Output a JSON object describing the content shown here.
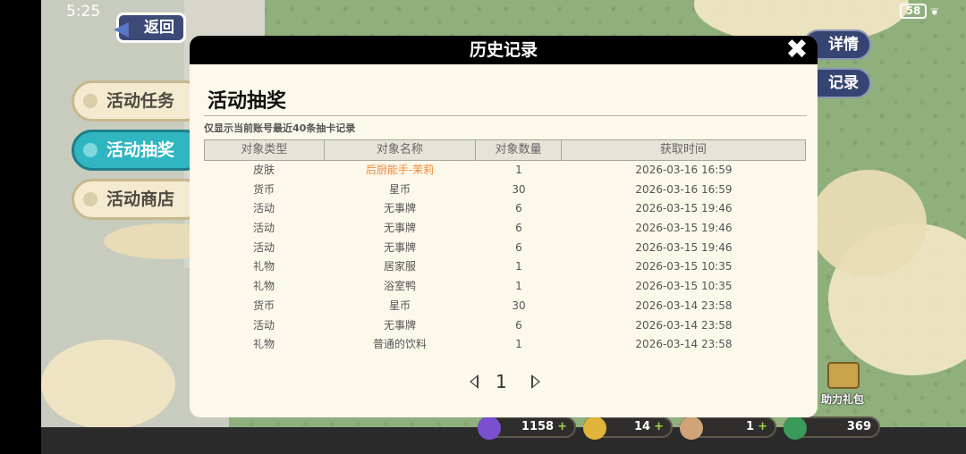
{
  "status": {
    "time": "5:25",
    "battery": "58"
  },
  "nav": {
    "back_label": "返回"
  },
  "sidebar": {
    "tabs": [
      {
        "label": "活动任务",
        "active": false
      },
      {
        "label": "活动抽奖",
        "active": true
      },
      {
        "label": "活动商店",
        "active": false
      }
    ]
  },
  "right_buttons": {
    "details": "详情",
    "records": "记录"
  },
  "gift_pack": {
    "label": "助力礼包"
  },
  "currencies": [
    {
      "icon": "purple-gem-icon",
      "value": "1158",
      "plus": "+"
    },
    {
      "icon": "gold-coin-icon",
      "value": "14",
      "plus": "+"
    },
    {
      "icon": "avatar-token-icon",
      "value": "1",
      "plus": "+"
    },
    {
      "icon": "green-ticket-icon",
      "value": "369"
    }
  ],
  "modal": {
    "title": "历史记录",
    "close_symbol": "✖",
    "section_title": "活动抽奖",
    "note": "仅显示当前账号最近40条抽卡记录",
    "columns": [
      "对象类型",
      "对象名称",
      "对象数量",
      "获取时间"
    ],
    "rows": [
      [
        "皮肤",
        "后厨能手-茉莉",
        "1",
        "2026-03-16 16:59"
      ],
      [
        "货币",
        "星币",
        "30",
        "2026-03-16 16:59"
      ],
      [
        "活动",
        "无事牌",
        "6",
        "2026-03-15 19:46"
      ],
      [
        "活动",
        "无事牌",
        "6",
        "2026-03-15 19:46"
      ],
      [
        "活动",
        "无事牌",
        "6",
        "2026-03-15 19:46"
      ],
      [
        "礼物",
        "居家服",
        "1",
        "2026-03-15 10:35"
      ],
      [
        "礼物",
        "浴室鸭",
        "1",
        "2026-03-15 10:35"
      ],
      [
        "货币",
        "星币",
        "30",
        "2026-03-14 23:58"
      ],
      [
        "活动",
        "无事牌",
        "6",
        "2026-03-14 23:58"
      ],
      [
        "礼物",
        "普通的饮料",
        "1",
        "2026-03-14 23:58"
      ]
    ],
    "highlight_row": 0,
    "page": "1"
  },
  "colors": {
    "accent_active_tab": "#2fb6c1",
    "highlight_text": "#f08a3c",
    "header_bg": "#000000"
  }
}
